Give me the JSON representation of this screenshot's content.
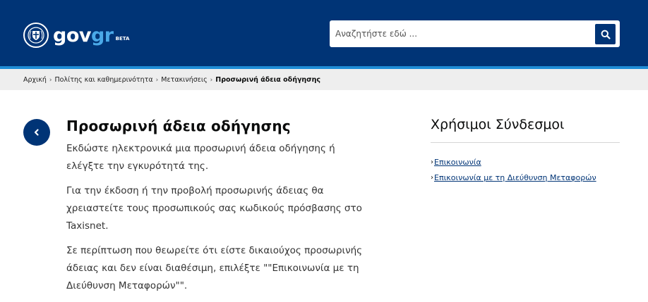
{
  "header": {
    "brand_gov": "gov",
    "brand_gr": "gr",
    "beta": "BETA",
    "emblem_icon": "greek-coat-of-arms-icon",
    "colors": {
      "background": "#003476",
      "accent": "#1f8dd6",
      "gr": "#4aa9e8"
    }
  },
  "search": {
    "placeholder": "Αναζητήστε εδώ ...",
    "value": "",
    "button_icon": "search-icon"
  },
  "breadcrumb": {
    "items": [
      "Αρχική",
      "Πολίτης και καθημερινότητα",
      "Μετακινήσεις"
    ],
    "current": "Προσωρινή άδεια οδήγησης"
  },
  "main": {
    "back_icon": "chevron-left-icon",
    "title": "Προσωρινή άδεια οδήγησης",
    "paragraphs": [
      "Εκδώστε ηλεκτρονικά μια προσωρινή άδεια οδήγησης ή ελέγξτε την εγκυρότητά της.",
      "Για την έκδοση ή την προβολή προσωρινής άδειας θα χρειαστείτε τους προσωπικούς σας κωδικούς πρόσβασης στο Taxisnet.",
      "Σε περίπτωση που θεωρείτε ότι είστε δικαιούχος προσωρινής άδειας και δεν είναι διαθέσιμη, επιλέξτε \"\"Επικοινωνία με τη Διεύθυνση Μεταφορών\"\"."
    ]
  },
  "sidebar": {
    "title": "Χρήσιμοι Σύνδεσμοι",
    "links": [
      "Επικοινωνία",
      "Επικοινωνία με τη Διεύθυνση Μεταφορών"
    ]
  }
}
